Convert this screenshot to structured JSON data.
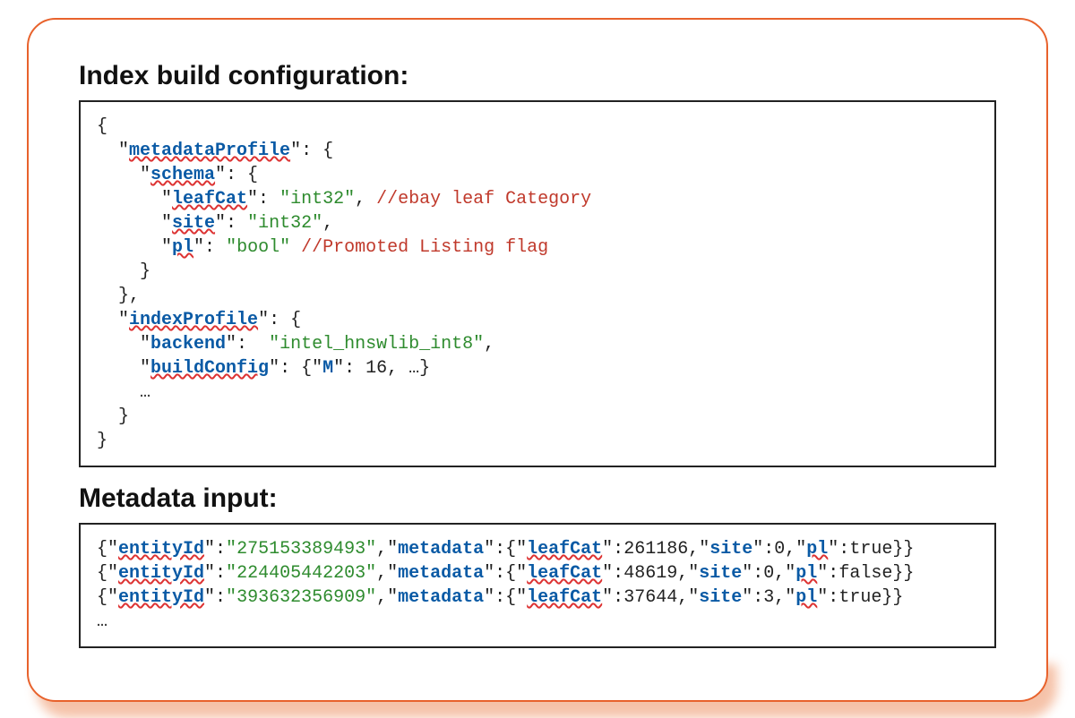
{
  "sections": {
    "config_title": "Index build configuration:",
    "metadata_title": "Metadata input:"
  },
  "config": {
    "metadataProfile_key": "metadataProfile",
    "schema_key": "schema",
    "schema": {
      "leafCat_key": "leafCat",
      "leafCat_type": "int32",
      "leafCat_comment": "//ebay leaf Category",
      "site_key": "site",
      "site_type": "int32",
      "pl_key": "pl",
      "pl_type": "bool",
      "pl_comment": "//Promoted Listing flag"
    },
    "indexProfile_key": "indexProfile",
    "indexProfile": {
      "backend_key": "backend",
      "backend_val": "intel_hnswlib_int8",
      "buildConfig_key": "buildConfig",
      "buildConfig_M_key": "M",
      "buildConfig_M_val": "16",
      "ellipsis": "…"
    }
  },
  "metadata_rows": [
    {
      "entityId": "275153389493",
      "leafCat": "261186",
      "site": "0",
      "pl": "true"
    },
    {
      "entityId": "224405442203",
      "leafCat": "48619",
      "site": "0",
      "pl": "false"
    },
    {
      "entityId": "393632356909",
      "leafCat": "37644",
      "site": "3",
      "pl": "true"
    }
  ],
  "labels": {
    "entityId": "entityId",
    "metadata": "metadata",
    "leafCat": "leafCat",
    "site": "site",
    "pl": "pl",
    "ellipsis": "…"
  }
}
